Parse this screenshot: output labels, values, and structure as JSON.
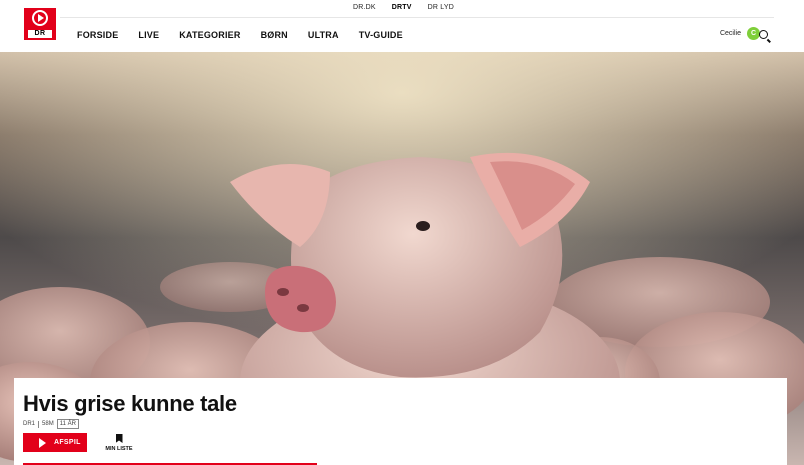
{
  "top_links": [
    "DR.DK",
    "DRTV",
    "DR LYD"
  ],
  "logo_text": "DR",
  "nav": {
    "items": [
      "FORSIDE",
      "LIVE",
      "KATEGORIER",
      "BØRN",
      "ULTRA",
      "TV-GUIDE"
    ]
  },
  "user": {
    "name": "Cecilie",
    "initial": "C"
  },
  "program": {
    "title": "Hvis grise kunne tale",
    "channel": "DR1",
    "duration": "58M",
    "rating": "11 ÅR",
    "play_label": "AFSPIL",
    "mylist_label": "MIN LISTE",
    "progress_fraction": 0.39
  },
  "colors": {
    "brand_red": "#e2001a",
    "avatar_green": "#7fcf3a"
  },
  "icons": [
    "dr-logo-icon",
    "search-icon",
    "play-icon",
    "bookmark-icon"
  ]
}
